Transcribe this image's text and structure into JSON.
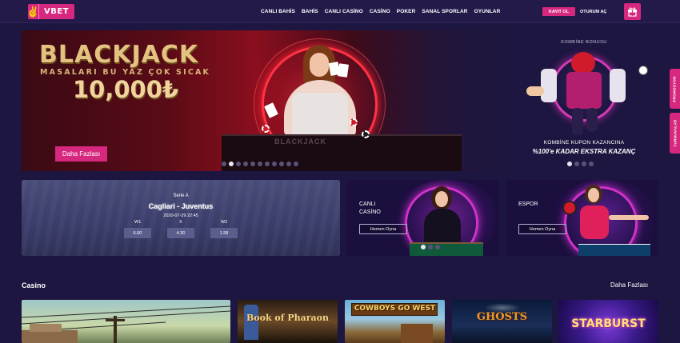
{
  "header": {
    "logo_mark": "✌",
    "logo_text": "VBET",
    "nav": [
      "CANLI BAHİS",
      "BAHİS",
      "CANLI CASİNO",
      "CASİNO",
      "POKER",
      "SANAL SPORLAR",
      "OYUNLAR"
    ],
    "register_label": "KAYIT OL",
    "login_label": "OTURUM AÇ",
    "gift_icon": "gift-icon"
  },
  "hero": {
    "title": "BLACKJACK",
    "subtitle": "MASALARI BU YAZ ÇOK SICAK",
    "amount": "10,000₺",
    "table_text": "BLACKJACK",
    "more_label": "Daha Fazlası",
    "slides_total": 11,
    "active_slide": 2
  },
  "promo": {
    "top_label": "KOMBİNE BONUSU",
    "line1": "KOMBİNE KUPON KAZANCINA",
    "line2": "%100'e KADAR EKSTRA KAZANÇ",
    "slides_total": 4,
    "active_slide": 1
  },
  "side_tabs": [
    "PROMOSYON",
    "TURNUVALAR"
  ],
  "match": {
    "league": "Serie A",
    "teams": "Cagliari - Juventus",
    "date": "2020-07-29 22:45",
    "odds": [
      {
        "label": "W1",
        "value": "6.00"
      },
      {
        "label": "X",
        "value": "4.30"
      },
      {
        "label": "W2",
        "value": "1.58"
      }
    ]
  },
  "games": [
    {
      "title_line1": "CANLI",
      "title_line2": "CASİNO",
      "button": "Hemen Oyna"
    },
    {
      "title_line1": "ESPOR",
      "title_line2": "",
      "button": "Hemen Oyna"
    }
  ],
  "casino": {
    "title": "Casino",
    "more_label": "Daha Fazlası",
    "tiles": [
      "",
      "Book of Pharaon",
      "COWBOYS GO WEST",
      "GHOSTS",
      "STARBURST"
    ]
  },
  "colors": {
    "accent": "#d6287e",
    "background": "#1d1640",
    "header": "#231a4a"
  }
}
